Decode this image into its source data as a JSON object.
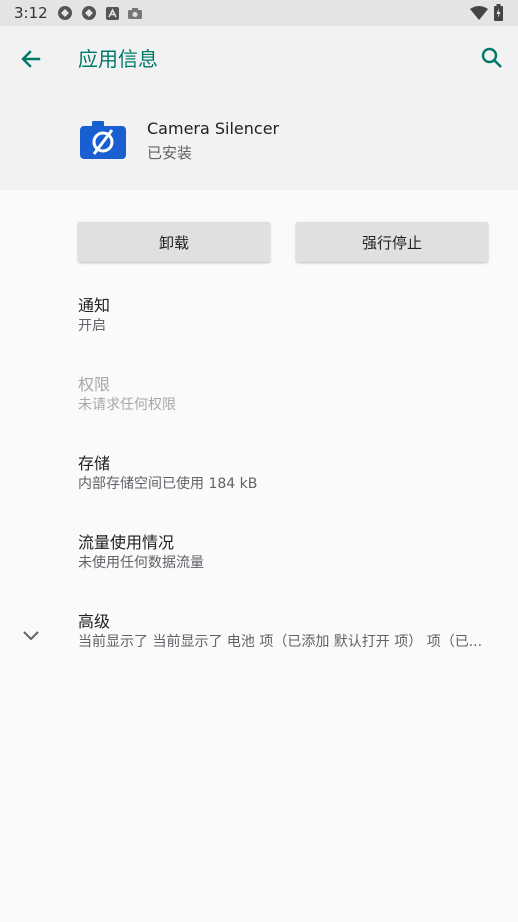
{
  "status_bar": {
    "time": "3:12",
    "icons": [
      "sync-icon",
      "sync-icon",
      "a-icon",
      "camera-icon",
      "wifi-icon",
      "battery-icon"
    ]
  },
  "header": {
    "title": "应用信息",
    "back_icon": "arrow-back-icon",
    "search_icon": "search-icon",
    "accent_color": "#00796b"
  },
  "app": {
    "name": "Camera Silencer",
    "status": "已安装",
    "icon": "camera-off-icon",
    "icon_color": "#1a5fd1"
  },
  "buttons": {
    "uninstall": "卸载",
    "force_stop": "强行停止"
  },
  "items": [
    {
      "title": "通知",
      "summary": "开启",
      "enabled": true
    },
    {
      "title": "权限",
      "summary": "未请求任何权限",
      "enabled": false
    },
    {
      "title": "存储",
      "summary": "内部存储空间已使用 184 kB",
      "enabled": true
    },
    {
      "title": "流量使用情况",
      "summary": "未使用任何数据流量",
      "enabled": true
    }
  ],
  "advanced": {
    "title": "高级",
    "summary": "当前显示了 当前显示了 电池 项（已添加 默认打开 项） 项（已...",
    "icon": "chevron-down-icon"
  }
}
